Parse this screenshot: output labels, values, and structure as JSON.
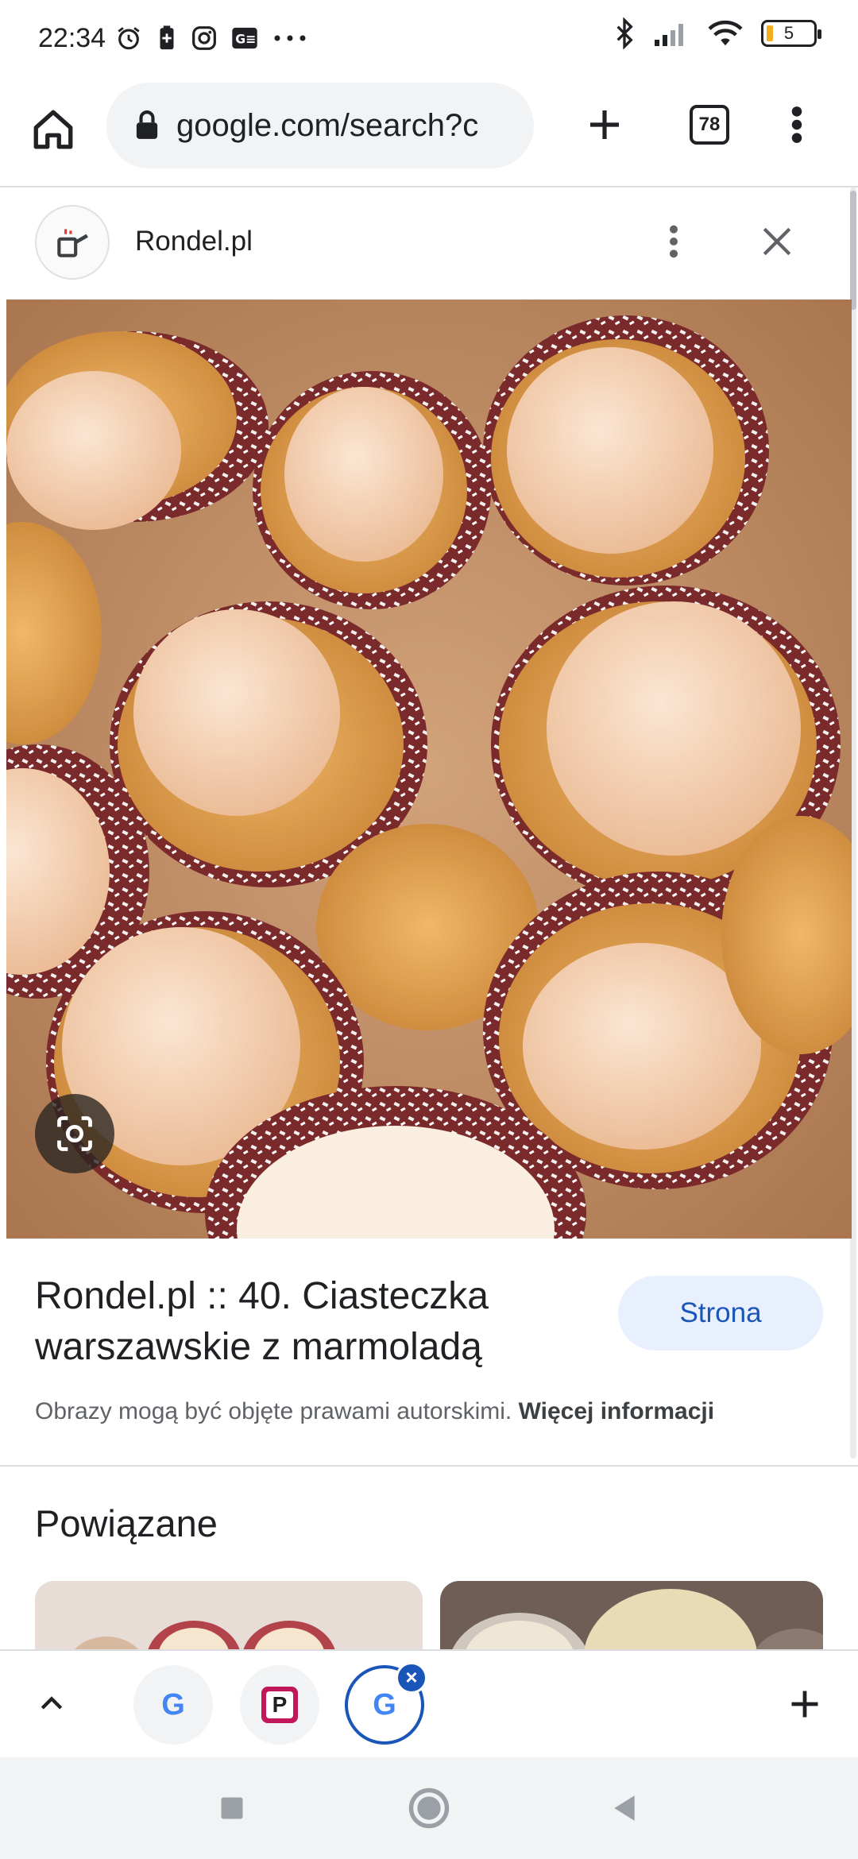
{
  "status": {
    "time": "22:34",
    "battery": "5"
  },
  "toolbar": {
    "url": "google.com/search?c",
    "tab_count": "78"
  },
  "source": {
    "name": "Rondel.pl"
  },
  "result": {
    "title": "Rondel.pl :: 40. Ciasteczka warszawskie z marmoladą",
    "visit_label": "Strona",
    "copyright_text": "Obrazy mogą być objęte prawami autorskimi.",
    "copyright_link": "Więcej informacji"
  },
  "related": {
    "title": "Powiązane"
  },
  "tabs": [
    {
      "label": "G",
      "color": "#4285f4"
    },
    {
      "label": "P",
      "color": "#c2185b"
    },
    {
      "label": "G",
      "color": "#4285f4"
    }
  ],
  "colors": {
    "accent": "#1a56b8",
    "chip_bg": "#e8f0fe"
  }
}
